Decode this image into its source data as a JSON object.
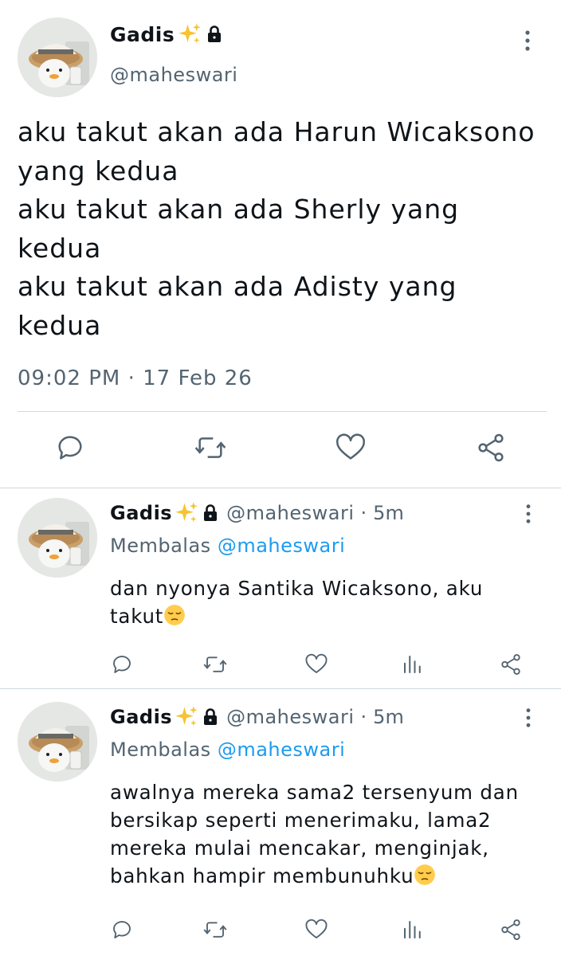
{
  "main_tweet": {
    "display_name": "Gadis",
    "handle": "@maheswari",
    "text_lines": [
      "aku takut akan ada Harun Wicaksono",
      "yang kedua",
      "aku takut akan ada Sherly yang",
      "kedua",
      "aku takut akan ada Adisty yang",
      "kedua"
    ],
    "timestamp": "09:02 PM · 17 Feb 26",
    "actions": [
      "reply-icon",
      "retweet-icon",
      "like-icon",
      "share-icon"
    ]
  },
  "replies": [
    {
      "display_name": "Gadis",
      "handle": "@maheswari",
      "dot": "·",
      "time": "5m",
      "replying_label": "Membalas",
      "replying_to": "@maheswari",
      "text_lines": [
        "dan nyonya Santika Wicaksono, aku",
        "takut"
      ],
      "trailing_emoji": "pensive-face",
      "actions": [
        "reply-icon",
        "retweet-icon",
        "like-icon",
        "views-icon",
        "share-icon"
      ]
    },
    {
      "display_name": "Gadis",
      "handle": "@maheswari",
      "dot": "·",
      "time": "5m",
      "replying_label": "Membalas",
      "replying_to": "@maheswari",
      "text_lines": [
        "awalnya mereka sama2 tersenyum dan",
        "bersikap seperti menerimaku, lama2",
        "mereka mulai mencakar, menginjak,",
        "bahkan hampir membunuhku"
      ],
      "trailing_emoji": "pensive-face",
      "actions": [
        "reply-icon",
        "retweet-icon",
        "like-icon",
        "views-icon",
        "share-icon"
      ]
    }
  ],
  "colors": {
    "text": "#0f1419",
    "secondary": "#536471",
    "link": "#1d9bf0",
    "divider": "#cfd9de",
    "sparkle": "#f7c331"
  }
}
